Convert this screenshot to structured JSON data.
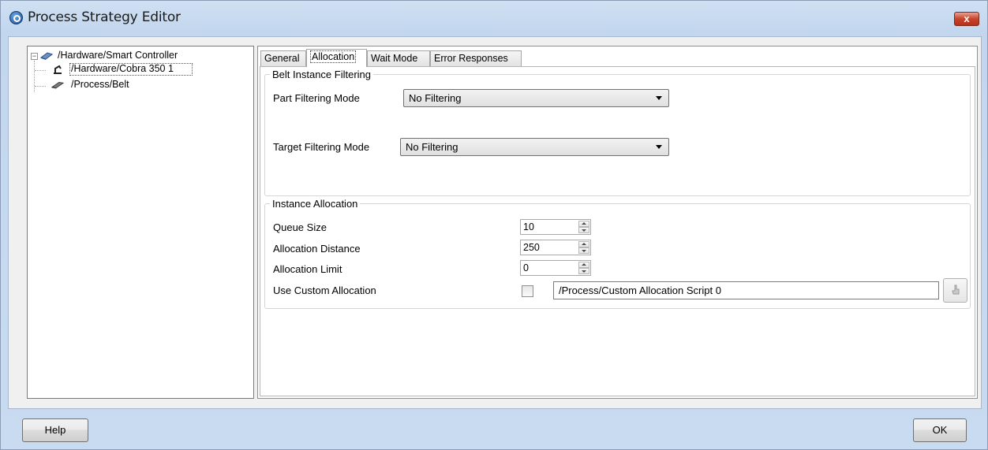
{
  "window": {
    "title": "Process Strategy Editor",
    "close_label": "x"
  },
  "tree": {
    "items": [
      {
        "label": "/Hardware/Smart Controller",
        "icon": "controller-icon"
      },
      {
        "label": "/Hardware/Cobra 350 1",
        "icon": "robot-arm-icon"
      },
      {
        "label": "/Process/Belt",
        "icon": "belt-icon"
      }
    ]
  },
  "tabs": [
    {
      "label": "General"
    },
    {
      "label": "Allocation"
    },
    {
      "label": "Wait Mode"
    },
    {
      "label": "Error Responses"
    }
  ],
  "belt_filtering": {
    "legend": "Belt Instance Filtering",
    "part_mode_label": "Part Filtering Mode",
    "part_mode_value": "No Filtering",
    "target_mode_label": "Target Filtering Mode",
    "target_mode_value": "No Filtering"
  },
  "instance_allocation": {
    "legend": "Instance Allocation",
    "queue_size_label": "Queue Size",
    "queue_size_value": "10",
    "distance_label": "Allocation Distance",
    "distance_value": "250",
    "limit_label": "Allocation Limit",
    "limit_value": "0",
    "custom_label": "Use Custom Allocation",
    "custom_checked": false,
    "custom_script": "/Process/Custom Allocation Script 0"
  },
  "footer": {
    "help_label": "Help",
    "ok_label": "OK"
  }
}
